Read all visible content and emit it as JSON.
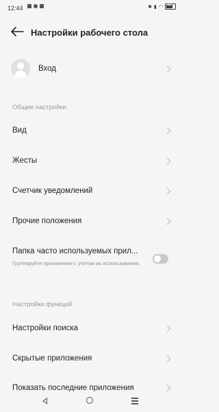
{
  "status_bar": {
    "time": "12:44",
    "battery": "43"
  },
  "header": {
    "title": "Настройки рабочего стола"
  },
  "account": {
    "label": "Вход"
  },
  "general_section": {
    "title": "Общие настройки",
    "items": [
      {
        "label": "Вид"
      },
      {
        "label": "Жесты"
      },
      {
        "label": "Счетчик уведомлений"
      },
      {
        "label": "Прочие положения"
      }
    ]
  },
  "folder_setting": {
    "label": "Папка часто используемых прил...",
    "description": "Группируйте приложения с учетом их использования.",
    "enabled": false
  },
  "features_section": {
    "title": "Настройки функций",
    "items": [
      {
        "label": "Настройки поиска"
      },
      {
        "label": "Скрытые приложения"
      },
      {
        "label": "Показать последние приложения"
      }
    ]
  },
  "icons": {
    "back": "arrow-left-icon",
    "chevron": "chevron-right-icon",
    "avatar": "user-avatar-icon",
    "nav_back": "triangle-back-icon",
    "nav_home": "circle-home-icon",
    "nav_menu": "menu-lines-icon"
  }
}
